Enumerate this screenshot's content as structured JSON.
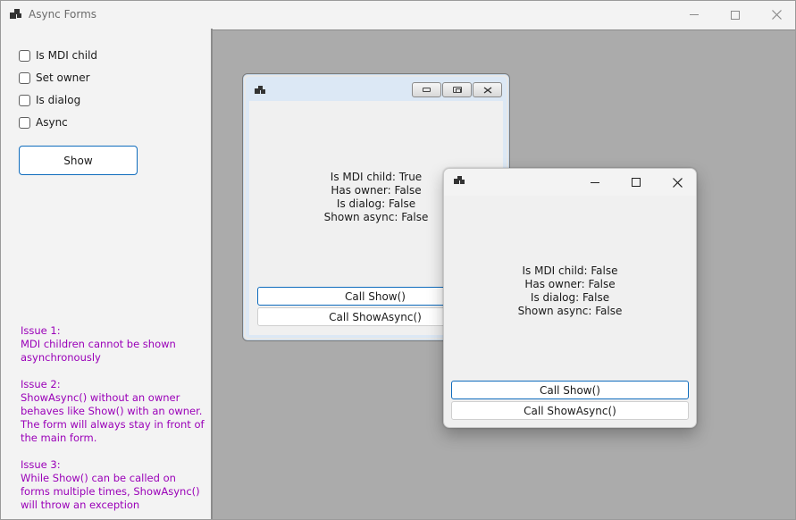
{
  "window": {
    "title": "Async Forms",
    "icons": {
      "app": "app-icon",
      "minimize": "minimize-icon",
      "maximize": "maximize-icon",
      "close": "close-icon"
    }
  },
  "left_panel": {
    "checkboxes": [
      {
        "label": "Is MDI child",
        "checked": false
      },
      {
        "label": "Set owner",
        "checked": false
      },
      {
        "label": "Is dialog",
        "checked": false
      },
      {
        "label": "Async",
        "checked": false
      }
    ],
    "show_button": "Show",
    "issues": [
      {
        "title": "Issue 1:",
        "text": "MDI children cannot be shown asynchronously"
      },
      {
        "title": "Issue 2:",
        "text": "ShowAsync() without an owner behaves like Show() with an owner. The form will always stay in front of the main form."
      },
      {
        "title": "Issue 3:",
        "text": "While Show() can be called on forms multiple times, ShowAsync() will throw an exception"
      }
    ]
  },
  "mdi_child": {
    "lines": [
      "Is MDI child: True",
      "Has owner: False",
      "Is dialog: False",
      "Shown async: False"
    ],
    "call_show": "Call Show()",
    "call_show_async": "Call ShowAsync()"
  },
  "floating_form": {
    "lines": [
      "Is MDI child: False",
      "Has owner: False",
      "Is dialog: False",
      "Shown async: False"
    ],
    "call_show": "Call Show()",
    "call_show_async": "Call ShowAsync()"
  },
  "colors": {
    "accent": "#0f6cbd",
    "issue_text": "#9a00b8",
    "mdi_background": "#ababab"
  }
}
